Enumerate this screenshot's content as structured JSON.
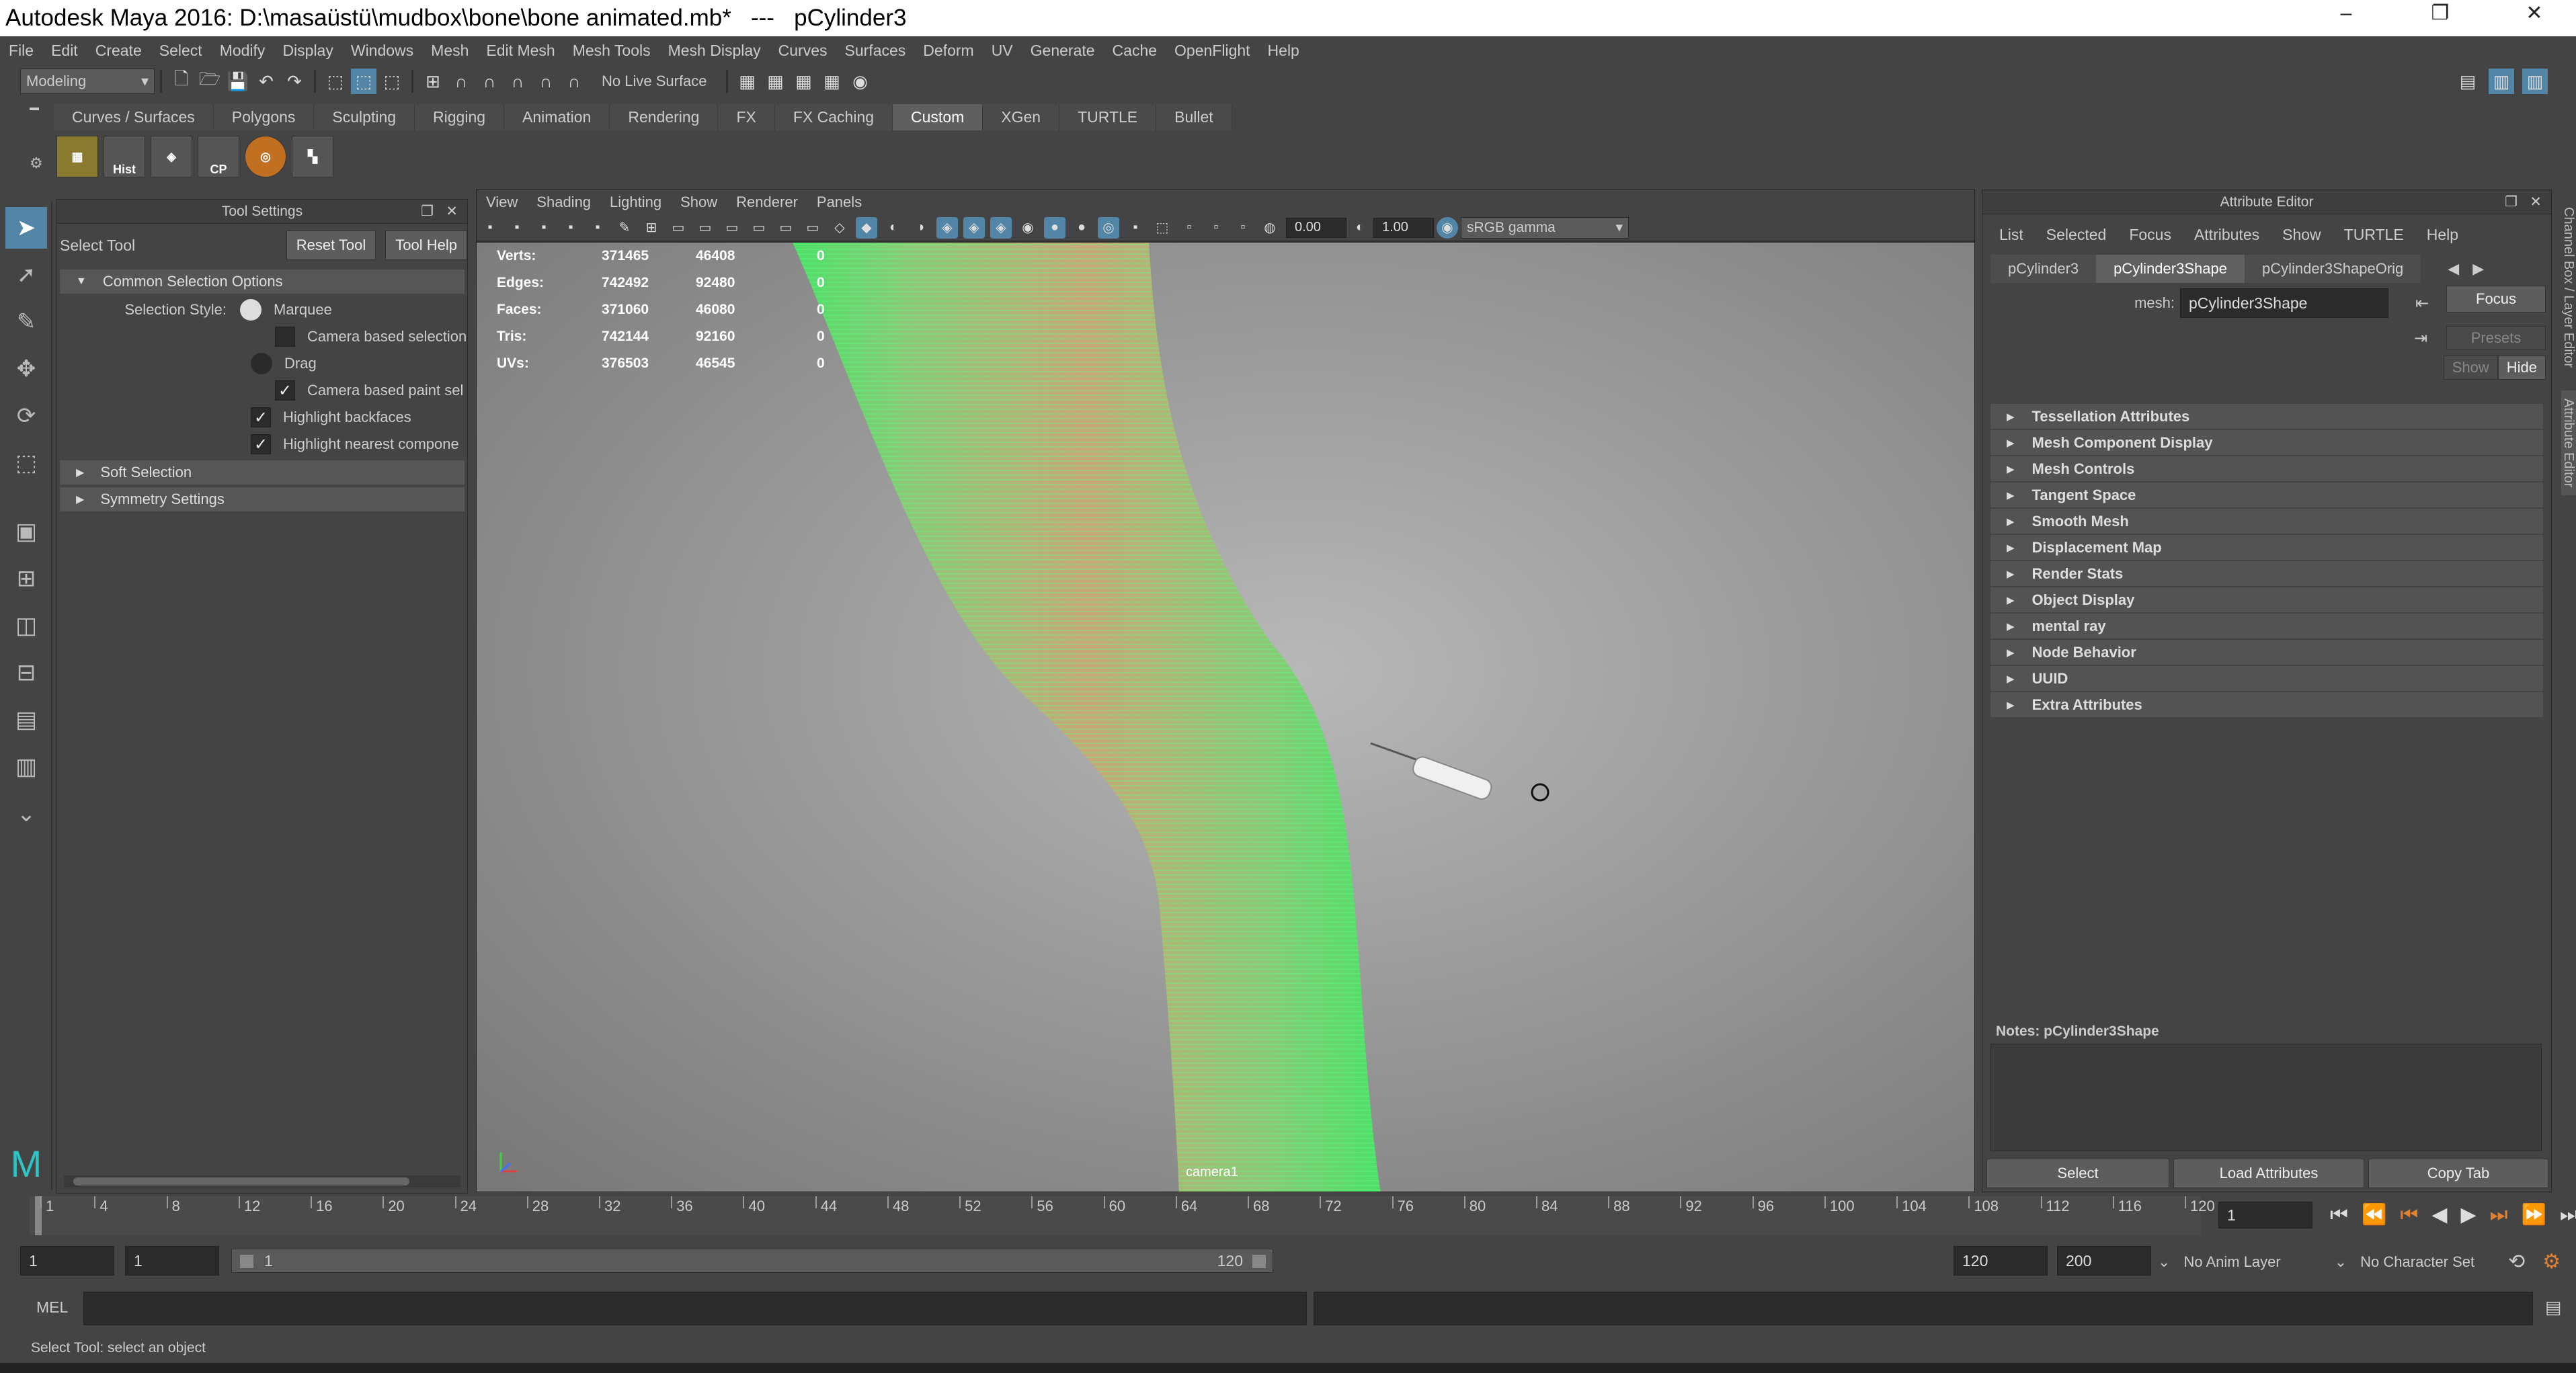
{
  "window": {
    "title": "Autodesk Maya 2016: D:\\masaüstü\\mudbox\\bone\\bone animated.mb*   ---   pCylinder3"
  },
  "menubar": [
    "File",
    "Edit",
    "Create",
    "Select",
    "Modify",
    "Display",
    "Windows",
    "Mesh",
    "Edit Mesh",
    "Mesh Tools",
    "Mesh Display",
    "Curves",
    "Surfaces",
    "Deform",
    "UV",
    "Generate",
    "Cache",
    "OpenFlight",
    "Help"
  ],
  "statusline": {
    "mode": "Modeling",
    "live_surface": "No Live Surface"
  },
  "shelf": {
    "tabs": [
      "Curves / Surfaces",
      "Polygons",
      "Sculpting",
      "Rigging",
      "Animation",
      "Rendering",
      "FX",
      "FX Caching",
      "Custom",
      "XGen",
      "TURTLE",
      "Bullet"
    ],
    "active_tab": "Custom",
    "icon_labels": [
      "Hist",
      "CP"
    ]
  },
  "tool_settings": {
    "title": "Tool Settings",
    "tool_name": "Select Tool",
    "reset_label": "Reset Tool",
    "help_label": "Tool Help",
    "common_section": "Common Selection Options",
    "selection_style_label": "Selection Style:",
    "marquee": "Marquee",
    "camera_based_selection": "Camera based selection",
    "drag": "Drag",
    "camera_based_paint": "Camera based paint sel",
    "highlight_backfaces": "Highlight backfaces",
    "highlight_nearest": "Highlight nearest compone",
    "soft_selection": "Soft Selection",
    "symmetry_settings": "Symmetry Settings"
  },
  "viewport": {
    "menu": [
      "View",
      "Shading",
      "Lighting",
      "Show",
      "Renderer",
      "Panels"
    ],
    "exposure": "0.00",
    "gamma": "1.00",
    "colorspace": "sRGB gamma",
    "camera": "camera1",
    "hud": [
      {
        "label": "Verts:",
        "a": "371465",
        "b": "46408",
        "c": "0"
      },
      {
        "label": "Edges:",
        "a": "742492",
        "b": "92480",
        "c": "0"
      },
      {
        "label": "Faces:",
        "a": "371060",
        "b": "46080",
        "c": "0"
      },
      {
        "label": "Tris:",
        "a": "742144",
        "b": "92160",
        "c": "0"
      },
      {
        "label": "UVs:",
        "a": "376503",
        "b": "46545",
        "c": "0"
      }
    ]
  },
  "attribute_editor": {
    "title": "Attribute Editor",
    "menu": [
      "List",
      "Selected",
      "Focus",
      "Attributes",
      "Show",
      "TURTLE",
      "Help"
    ],
    "tabs": [
      "pCylinder3",
      "pCylinder3Shape",
      "pCylinder3ShapeOrig"
    ],
    "active_tab": "pCylinder3Shape",
    "mesh_label": "mesh:",
    "mesh_value": "pCylinder3Shape",
    "focus": "Focus",
    "presets": "Presets",
    "show": "Show",
    "hide": "Hide",
    "sections": [
      "Tessellation Attributes",
      "Mesh Component Display",
      "Mesh Controls",
      "Tangent Space",
      "Smooth Mesh",
      "Displacement Map",
      "Render Stats",
      "Object Display",
      "mental ray",
      "Node Behavior",
      "UUID",
      "Extra Attributes"
    ],
    "notes_label": "Notes:  pCylinder3Shape",
    "select": "Select",
    "load_attributes": "Load Attributes",
    "copy_tab": "Copy Tab"
  },
  "side_tabs": [
    "Channel Box / Layer Editor",
    "Attribute Editor"
  ],
  "timeline": {
    "ticks": [
      "1",
      "4",
      "8",
      "12",
      "16",
      "20",
      "24",
      "28",
      "32",
      "36",
      "40",
      "44",
      "48",
      "52",
      "56",
      "60",
      "64",
      "68",
      "72",
      "76",
      "80",
      "84",
      "88",
      "92",
      "96",
      "100",
      "104",
      "108",
      "112",
      "116",
      "120"
    ],
    "current_frame": "1"
  },
  "range": {
    "start": "1",
    "playback_start": "1",
    "slider_start": "1",
    "slider_end": "120",
    "playback_end": "120",
    "end": "200",
    "anim_layer": "No Anim Layer",
    "char_set": "No Character Set"
  },
  "command": {
    "lang": "MEL"
  },
  "help_line": "Select Tool: select an object"
}
